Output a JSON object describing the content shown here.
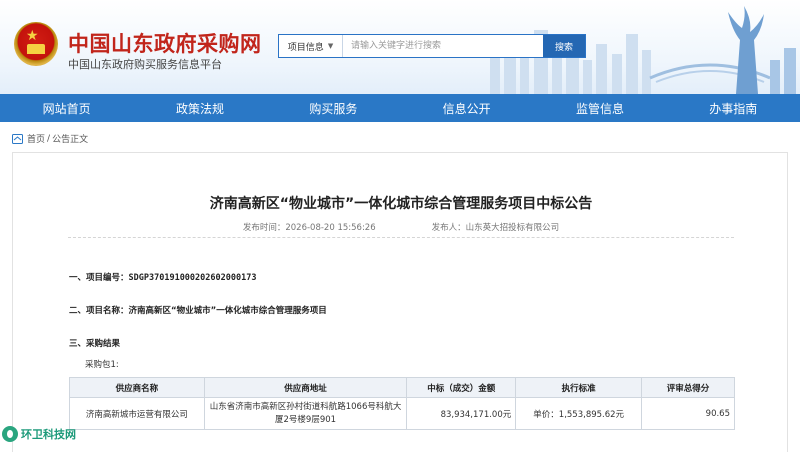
{
  "header": {
    "title": "中国山东政府采购网",
    "subtitle": "中国山东政府购买服务信息平台",
    "search": {
      "type_label": "项目信息",
      "placeholder": "请输入关键字进行搜索",
      "button_label": "搜索"
    }
  },
  "nav": {
    "items": [
      "网站首页",
      "政策法规",
      "购买服务",
      "信息公开",
      "监管信息",
      "办事指南"
    ]
  },
  "breadcrumb": {
    "home": "首页",
    "separator": "/",
    "current": "公告正文"
  },
  "article": {
    "title": "济南高新区“物业城市”一体化城市综合管理服务项目中标公告",
    "publish_time": "发布时间：2026-08-20 15:56:26",
    "publisher": "发布人：山东英大招投标有限公司",
    "section1_label": "一、项目编号：",
    "section1_value": "SDGP370191000202602000173",
    "section2_label": "二、项目名称：",
    "section2_value": "济南高新区“物业城市”一体化城市综合管理服务项目",
    "section3_label": "三、采购结果",
    "package_label": "采购包1:",
    "table": {
      "headers": [
        "供应商名称",
        "供应商地址",
        "中标（成交）金额",
        "执行标准",
        "评审总得分"
      ],
      "rows": [
        {
          "supplier": "济南高新城市运营有限公司",
          "address": "山东省济南市高新区孙村街道科航路1066号科航大厦2号楼9层901",
          "amount": "83,934,171.00元",
          "standard": "单价：1,553,895.62元",
          "score": "90.65"
        }
      ]
    }
  },
  "watermark": "环卫科技网",
  "colors": {
    "brand_red": "#c1251b",
    "nav_blue": "#2a78c6",
    "search_blue": "#2467b3"
  }
}
